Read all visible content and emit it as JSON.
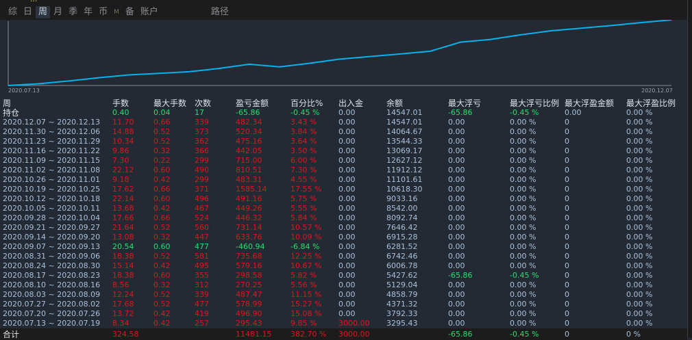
{
  "header": {
    "title": "...",
    "tabs": [
      "综",
      "日",
      "周",
      "月",
      "季",
      "年",
      "币",
      "M",
      "备",
      "账户",
      "路径"
    ],
    "active_tab": "周"
  },
  "chart": {
    "x_start": "2020.07.13",
    "x_end": "2020.12.07",
    "start_balance": 3000.0
  },
  "colors": {
    "up": "#e3141c",
    "down": "#22e070",
    "line": "#00b4f0"
  },
  "table": {
    "columns": [
      "周",
      "手数",
      "最大手数",
      "次数",
      "盈亏金额",
      "百分比%",
      "出入金",
      "余额",
      "最大浮亏",
      "最大浮亏比例",
      "最大浮盈金额",
      "最大浮盈比例"
    ],
    "holding": {
      "label": "持仓",
      "cells": [
        "0.40",
        "0.04",
        "17",
        "-65.86",
        "-0.45 %",
        "0.00",
        "14547.01",
        "-65.86",
        "-0.45 %",
        "0.00",
        "0.00 %"
      ],
      "sign": "down"
    },
    "rows": [
      [
        "2020.12.07 ~ 2020.12.13",
        "11.70",
        "0.66",
        "339",
        "482.34",
        "3.43 %",
        "0.00",
        "14547.01",
        "0.00",
        "0.00 %",
        "0",
        "0.00 %"
      ],
      [
        "2020.11.30 ~ 2020.12.06",
        "14.88",
        "0.52",
        "373",
        "520.34",
        "3.84 %",
        "0.00",
        "14064.67",
        "0.00",
        "0.00 %",
        "0",
        "0.00 %"
      ],
      [
        "2020.11.23 ~ 2020.11.29",
        "10.34",
        "0.52",
        "362",
        "475.16",
        "3.64 %",
        "0.00",
        "13544.33",
        "0.00",
        "0.00 %",
        "0",
        "0.00 %"
      ],
      [
        "2020.11.16 ~ 2020.11.22",
        "9.86",
        "0.32",
        "366",
        "442.05",
        "3.50 %",
        "0.00",
        "13069.17",
        "0.00",
        "0.00 %",
        "0",
        "0.00 %"
      ],
      [
        "2020.11.09 ~ 2020.11.15",
        "7.30",
        "0.22",
        "299",
        "715.00",
        "6.00 %",
        "0.00",
        "12627.12",
        "0.00",
        "0.00 %",
        "0",
        "0.00 %"
      ],
      [
        "2020.11.02 ~ 2020.11.08",
        "22.12",
        "0.60",
        "490",
        "810.51",
        "7.30 %",
        "0.00",
        "11912.12",
        "0.00",
        "0.00 %",
        "0",
        "0.00 %"
      ],
      [
        "2020.10.26 ~ 2020.11.01",
        "9.18",
        "0.42",
        "299",
        "483.31",
        "4.55 %",
        "0.00",
        "11101.61",
        "0.00",
        "0.00 %",
        "0",
        "0.00 %"
      ],
      [
        "2020.10.19 ~ 2020.10.25",
        "17.62",
        "0.66",
        "371",
        "1585.14",
        "17.55 %",
        "0.00",
        "10618.30",
        "0.00",
        "0.00 %",
        "0",
        "0.00 %"
      ],
      [
        "2020.10.12 ~ 2020.10.18",
        "22.14",
        "0.60",
        "496",
        "491.16",
        "5.75 %",
        "0.00",
        "9033.16",
        "0.00",
        "0.00 %",
        "0",
        "0.00 %"
      ],
      [
        "2020.10.05 ~ 2020.10.11",
        "13.68",
        "0.42",
        "467",
        "449.26",
        "5.55 %",
        "0.00",
        "8542.00",
        "0.00",
        "0.00 %",
        "0",
        "0.00 %"
      ],
      [
        "2020.09.28 ~ 2020.10.04",
        "17.66",
        "0.66",
        "524",
        "446.32",
        "5.84 %",
        "0.00",
        "8092.74",
        "0.00",
        "0.00 %",
        "0",
        "0.00 %"
      ],
      [
        "2020.09.21 ~ 2020.09.27",
        "21.64",
        "0.52",
        "560",
        "731.14",
        "10.57 %",
        "0.00",
        "7646.42",
        "0.00",
        "0.00 %",
        "0",
        "0.00 %"
      ],
      [
        "2020.09.14 ~ 2020.09.20",
        "13.08",
        "0.32",
        "447",
        "633.76",
        "10.09 %",
        "0.00",
        "6915.28",
        "0.00",
        "0.00 %",
        "0",
        "0.00 %"
      ],
      [
        "2020.09.07 ~ 2020.09.13",
        "20.54",
        "0.60",
        "477",
        "-460.94",
        "-6.84 %",
        "0.00",
        "6281.52",
        "0.00",
        "0.00 %",
        "0",
        "0.00 %"
      ],
      [
        "2020.08.31 ~ 2020.09.06",
        "18.38",
        "0.52",
        "581",
        "735.68",
        "12.25 %",
        "0.00",
        "6742.46",
        "0.00",
        "0.00 %",
        "0",
        "0.00 %"
      ],
      [
        "2020.08.24 ~ 2020.08.30",
        "15.14",
        "0.42",
        "495",
        "579.16",
        "10.67 %",
        "0.00",
        "6006.78",
        "0.00",
        "0.00 %",
        "0",
        "0.00 %"
      ],
      [
        "2020.08.17 ~ 2020.08.23",
        "18.38",
        "0.60",
        "355",
        "298.58",
        "5.82 %",
        "0.00",
        "5427.62",
        "-65.86",
        "-0.45 %",
        "0",
        "0.00 %"
      ],
      [
        "2020.08.10 ~ 2020.08.16",
        "8.56",
        "0.32",
        "312",
        "270.25",
        "5.56 %",
        "0.00",
        "5129.04",
        "0.00",
        "0.00 %",
        "0",
        "0.00 %"
      ],
      [
        "2020.08.03 ~ 2020.08.09",
        "12.24",
        "0.52",
        "339",
        "487.47",
        "11.15 %",
        "0.00",
        "4858.79",
        "0.00",
        "0.00 %",
        "0",
        "0.00 %"
      ],
      [
        "2020.07.27 ~ 2020.08.02",
        "17.68",
        "0.52",
        "477",
        "578.99",
        "15.27 %",
        "0.00",
        "4371.32",
        "0.00",
        "0.00 %",
        "0",
        "0.00 %"
      ],
      [
        "2020.07.20 ~ 2020.07.26",
        "13.72",
        "0.42",
        "419",
        "496.90",
        "15.08 %",
        "0.00",
        "3792.33",
        "0.00",
        "0.00 %",
        "0",
        "0.00 %"
      ],
      [
        "2020.07.13 ~ 2020.07.19",
        "8.34",
        "0.42",
        "257",
        "295.43",
        "9.85 %",
        "3000.00",
        "3295.43",
        "0.00",
        "0.00 %",
        "0",
        "0.00 %"
      ]
    ],
    "total": {
      "label": "合计",
      "cells": [
        "324.58",
        "",
        "",
        "11481.15",
        "382.70 %",
        "3000.00",
        "",
        "-65.86",
        "-0.45 %",
        "0",
        "0 %"
      ]
    }
  }
}
